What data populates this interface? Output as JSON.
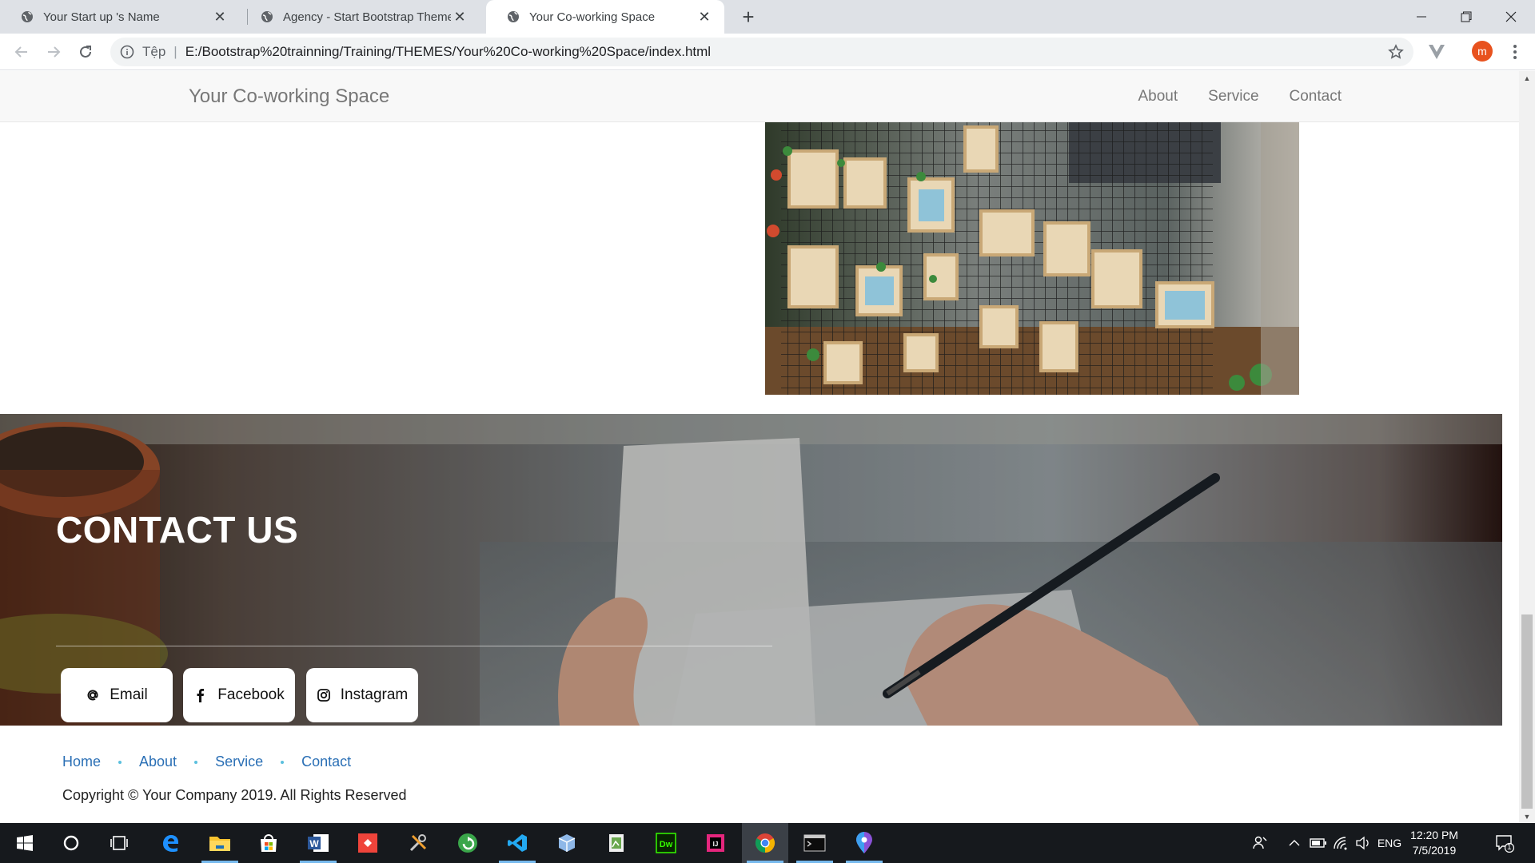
{
  "browser": {
    "tabs": [
      {
        "title": "Your Start up 's Name"
      },
      {
        "title": "Agency - Start Bootstrap Theme"
      },
      {
        "title": "Your Co-working Space"
      }
    ],
    "address": {
      "scheme_label": "Tệp",
      "url": "E:/Bootstrap%20trainning/Training/THEMES/Your%20Co-working%20Space/index.html"
    },
    "profile_initial": "m"
  },
  "site": {
    "brand": "Your Co-working Space",
    "nav": [
      "About",
      "Service",
      "Contact"
    ],
    "contact": {
      "title": "CONTACT US",
      "buttons": [
        {
          "label": "Email",
          "icon": "at-icon"
        },
        {
          "label": "Facebook",
          "icon": "facebook-icon"
        },
        {
          "label": "Instagram",
          "icon": "instagram-icon"
        }
      ]
    },
    "footer": {
      "links": [
        "Home",
        "About",
        "Service",
        "Contact"
      ],
      "copyright": "Copyright © Your Company 2019. All Rights Reserved"
    }
  },
  "taskbar": {
    "language": "ENG",
    "time": "12:20 PM",
    "date": "7/5/2019",
    "notification_count": "1",
    "apps": [
      "start-icon",
      "cortana-icon",
      "task-view-icon",
      "edge-icon",
      "file-explorer-icon",
      "store-icon",
      "word-icon",
      "anydesk-icon",
      "tools-icon",
      "app-green-icon",
      "vscode-icon",
      "box-icon",
      "sheet-icon",
      "dreamweaver-icon",
      "intellij-icon",
      "chrome-icon",
      "terminal-icon",
      "maps-icon"
    ]
  },
  "colors": {
    "footer_link": "#2a6fb5",
    "nav_text": "#777777",
    "accent_avatar": "#e8521e"
  }
}
